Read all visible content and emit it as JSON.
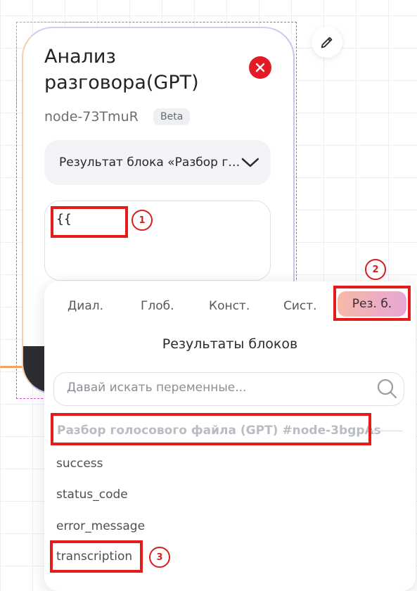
{
  "node": {
    "title": "Анализ разговора(GPT)",
    "node_id": "node-73TmuR",
    "badge": "Beta",
    "select_value": "Результат блока «Разбор голосового файла (GPT)»",
    "editor_value": "{{"
  },
  "popup": {
    "tabs": [
      "Диал.",
      "Глоб.",
      "Конст.",
      "Сист.",
      "Рез. б."
    ],
    "active_tab": "Рез. б.",
    "title": "Результаты блоков",
    "search_placeholder": "Давай искать переменные...",
    "group_title": "Разбор голосового файла (GPT) #node-3bgpAs",
    "variables": [
      "success",
      "status_code",
      "error_message",
      "transcription"
    ]
  },
  "annotations": [
    "1",
    "2",
    "3"
  ],
  "colors": {
    "accent_red": "#e41b1b",
    "close_red": "#e21b24",
    "active_tab_from": "#f6b9a6",
    "active_tab_to": "#e7a6d6",
    "selection_dash": "#d24ad8"
  },
  "icons": {
    "edit": "pencil-icon",
    "close": "close-icon",
    "select_toggle": "chevron-down-icon",
    "search": "search-icon"
  }
}
